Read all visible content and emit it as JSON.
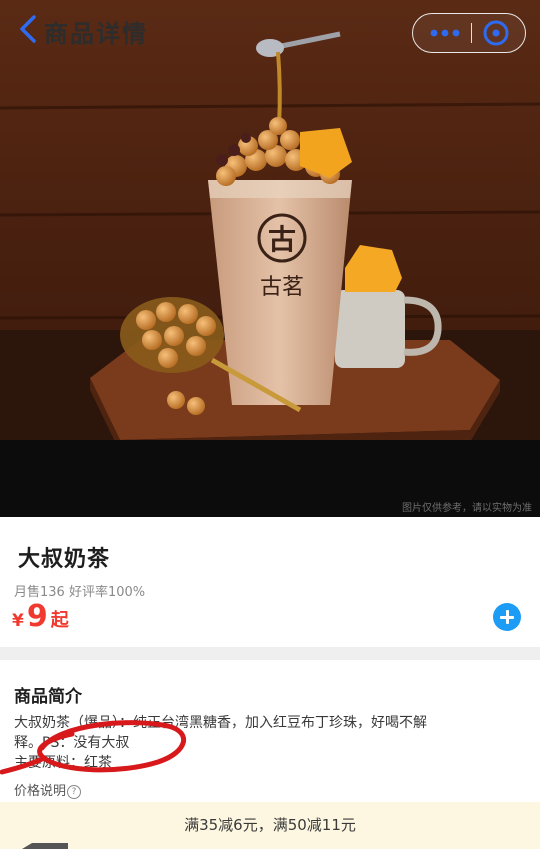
{
  "nav": {
    "title": "商品详情",
    "back_icon": "chevron-left-icon",
    "more_icon": "more-dots-icon",
    "close_icon": "close-circle-icon",
    "accent": "#2f6bf0"
  },
  "hero": {
    "cup_brand": "古茗",
    "cup_logo_char": "古",
    "caption": "图片仅供参考，请以实物为准"
  },
  "product": {
    "name": "大叔奶茶",
    "stats": "月售136 好评率100%",
    "currency": "¥",
    "price": "9",
    "price_suffix": "起",
    "price_color": "#f0392f",
    "add_icon": "plus-circle-icon",
    "add_color": "#1c9cf5"
  },
  "description": {
    "title": "商品简介",
    "line1": "大叔奶茶（爆品）：纯正台湾黑糖香，加入红豆布丁珍珠，好喝不解",
    "line2": "释。PS：没有大叔",
    "line3": "主要原料：红茶",
    "price_note": "价格说明",
    "annotation_color": "#d8191c"
  },
  "promo": {
    "text": "满35减6元，满50减11元"
  }
}
